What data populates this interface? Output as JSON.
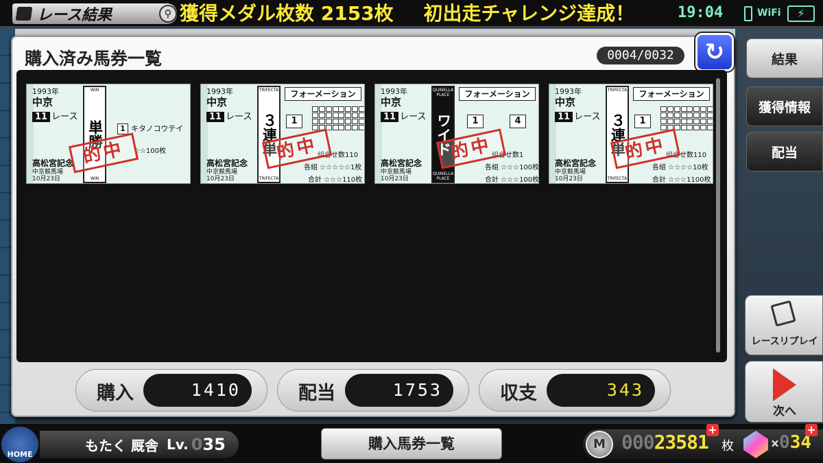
{
  "topbar": {
    "title": "レース結果",
    "ticker": [
      "獲得メダル枚数 2153枚",
      "初出走チャレンジ達成！"
    ],
    "time": "19:04",
    "wifi": "WiFi"
  },
  "panel": {
    "title": "購入済み馬券一覧",
    "counter_current": "0004",
    "counter_sep": "/",
    "counter_total": "0032",
    "back_icon": "↻"
  },
  "tickets": [
    {
      "year": "1993年",
      "venue": "中京",
      "race_no": "11",
      "race_label": "レース",
      "race_name": "高松宮記念",
      "place": "中京競馬場",
      "date": "10月23日",
      "type_en": "WIN",
      "type_kanji": "単勝",
      "horse_no": "1",
      "horse_name": "キタノコウテイ",
      "line1": "☆☆100枚",
      "stamp": "的中"
    },
    {
      "year": "1993年",
      "venue": "中京",
      "race_no": "11",
      "race_label": "レース",
      "race_name": "高松宮記念",
      "place": "中京競馬場",
      "date": "10月23日",
      "type_en": "TRIFECTA",
      "type_kanji": "３連単",
      "formation": "フォーメーション",
      "box1": "1",
      "combo": "組合せ数110",
      "line1": "各組 ☆☆☆☆☆1枚",
      "line2": "合計 ☆☆☆110枚",
      "stamp": "的中"
    },
    {
      "year": "1993年",
      "venue": "中京",
      "race_no": "11",
      "race_label": "レース",
      "race_name": "高松宮記念",
      "place": "中京競馬場",
      "date": "10月23日",
      "type_en": "QUINELLA PLACE",
      "type_kanji": "ワイド",
      "formation": "フォーメーション",
      "box1": "1",
      "box2": "4",
      "combo": "組合せ数1",
      "line1": "各組 ☆☆☆100枚",
      "line2": "合計 ☆☆☆100枚",
      "stamp": "的中"
    },
    {
      "year": "1993年",
      "venue": "中京",
      "race_no": "11",
      "race_label": "レース",
      "race_name": "高松宮記念",
      "place": "中京競馬場",
      "date": "10月23日",
      "type_en": "TRIFECTA",
      "type_kanji": "３連単",
      "formation": "フォーメーション",
      "box1": "1",
      "combo": "組合せ数110",
      "line1": "各組 ☆☆☆☆10枚",
      "line2": "合計 ☆☆☆1100枚",
      "stamp": "的中"
    }
  ],
  "stats": {
    "purchase_label": "購入",
    "purchase_value": "1410",
    "payout_label": "配当",
    "payout_value": "1753",
    "balance_label": "収支",
    "balance_value": "343"
  },
  "side": {
    "result": "結果",
    "info": "獲得情報",
    "payout": "配当",
    "replay": "レースリプレイ",
    "next": "次へ"
  },
  "bottom": {
    "home": "HOME",
    "player_name": "もたく 厩舎",
    "lv_label": "Lv.",
    "lv_zero": "0",
    "lv_value": "35",
    "list_button": "購入馬券一覧",
    "medal_zeros": "000",
    "medal_value": "23581",
    "medal_unit": "枚",
    "gem_x": "×",
    "gem_zero": "0",
    "gem_value": "34",
    "plus": "+"
  },
  "colors": {
    "accent_blue": "#1d3ccf",
    "stamp_red": "#d0302a",
    "gold": "#f4e23a",
    "clock_green": "#7cf0c0"
  }
}
